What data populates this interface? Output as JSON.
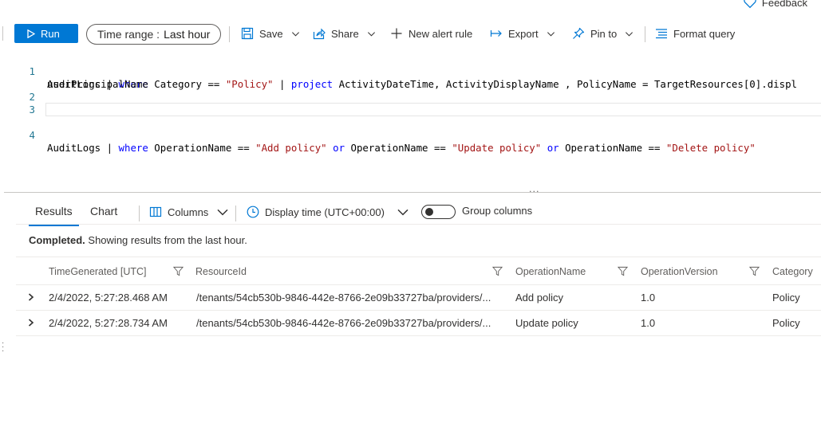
{
  "feedback": {
    "label": "Feedback"
  },
  "toolbar": {
    "run_label": "Run",
    "time_range_label": "Time range :",
    "time_range_value": "Last hour",
    "save_label": "Save",
    "share_label": "Share",
    "new_alert_label": "New alert rule",
    "export_label": "Export",
    "pin_label": "Pin to",
    "format_label": "Format query"
  },
  "editor": {
    "line_numbers": [
      "1",
      "2",
      "3",
      "4"
    ],
    "line1": {
      "t1": "AuditLogs | ",
      "k1": "where",
      "t2": " Category == ",
      "s1": "\"Policy\"",
      "t3": " | ",
      "k2": "project",
      "t4": " ActivityDateTime, ActivityDisplayName , PolicyName = TargetResources[0].displ"
    },
    "line1_wrap": "userPrincipalName",
    "line4": {
      "t1": "AuditLogs | ",
      "k1": "where",
      "t2": " OperationName == ",
      "s1": "\"Add policy\"",
      "k2": "or",
      "t3": " OperationName == ",
      "s2": "\"Update policy\"",
      "k3": "or",
      "t4": " OperationName == ",
      "s3": "\"Delete policy\""
    }
  },
  "results_bar": {
    "tab_results": "Results",
    "tab_chart": "Chart",
    "columns_label": "Columns",
    "display_time_label": "Display time (UTC+00:00)",
    "group_columns_label": "Group columns",
    "group_columns_on": false
  },
  "status": {
    "bold": "Completed.",
    "text": " Showing results from the last hour."
  },
  "grid": {
    "headers": [
      "TimeGenerated [UTC]",
      "ResourceId",
      "OperationName",
      "OperationVersion",
      "Category"
    ],
    "rows": [
      [
        "2/4/2022, 5:27:28.468 AM",
        "/tenants/54cb530b-9846-442e-8766-2e09b33727ba/providers/...",
        "Add policy",
        "1.0",
        "Policy"
      ],
      [
        "2/4/2022, 5:27:28.734 AM",
        "/tenants/54cb530b-9846-442e-8766-2e09b33727ba/providers/...",
        "Update policy",
        "1.0",
        "Policy"
      ]
    ]
  },
  "colors": {
    "accent": "#0078d4",
    "keyword": "#0000ff",
    "string": "#a31515"
  }
}
